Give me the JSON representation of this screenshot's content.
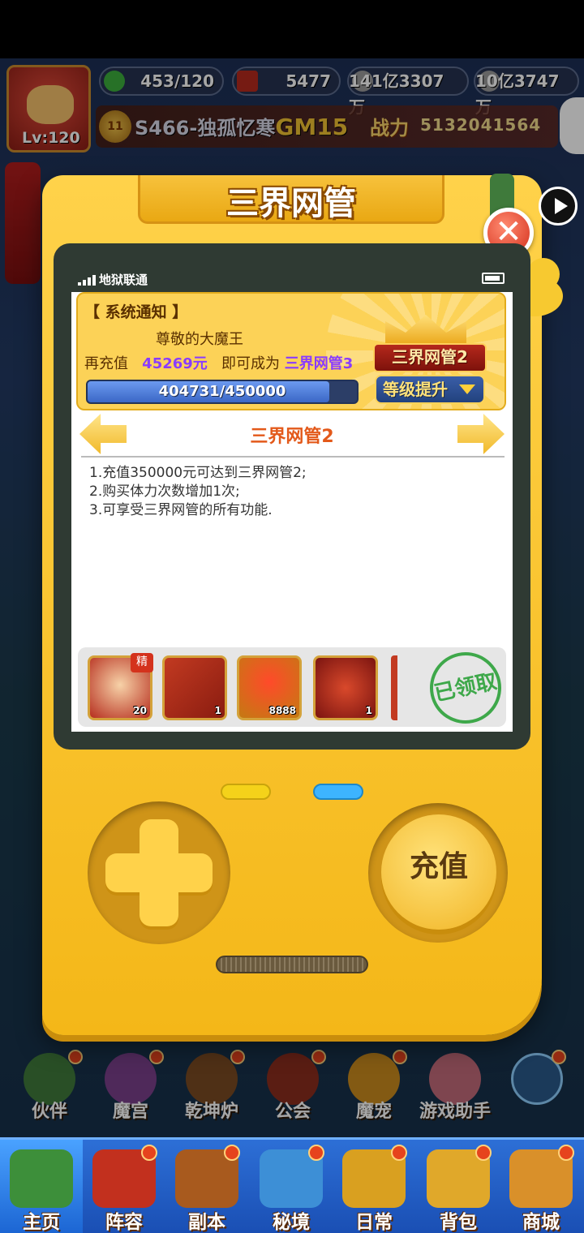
{
  "hud": {
    "level": "Lv:120",
    "stamina": "453/120",
    "gems": "5477",
    "coins": "141亿3307万",
    "silver": "10亿3747万",
    "server_name": "S466-独孤忆寒",
    "gm_tag": "GM15",
    "power_label": "战力",
    "power_value": "5132041564",
    "vip_badge": "11"
  },
  "modal": {
    "title": "三界网管",
    "close_symbol": "✕",
    "status_bar": {
      "carrier": "地狱联通"
    },
    "notice": {
      "header": "【 系统通知 】",
      "greeting": "尊敬的大魔王",
      "prefix": "再充值",
      "amount": "45269元",
      "middle": "即可成为",
      "target": "三界网管3",
      "progress_text": "404731/450000",
      "progress_ratio": 0.899,
      "rank": "三界网管2",
      "upgrade_label": "等级提升"
    },
    "level_title": "三界网管2",
    "description": [
      "1.充值350000元可达到三界网管2;",
      "2.购买体力次数增加1次;",
      "3.可享受三界网管的所有功能."
    ],
    "rewards": [
      {
        "tag": "精",
        "count": "20"
      },
      {
        "count": "1"
      },
      {
        "count": "8888"
      },
      {
        "count": "1"
      }
    ],
    "claimed_stamp": "已领取",
    "charge_button": "充值"
  },
  "icon_row": [
    {
      "label": "伙伴"
    },
    {
      "label": "魔宫"
    },
    {
      "label": "乾坤炉"
    },
    {
      "label": "公会"
    },
    {
      "label": "魔宠"
    },
    {
      "label": "游戏助手"
    }
  ],
  "nav": [
    {
      "label": "主页"
    },
    {
      "label": "阵容"
    },
    {
      "label": "副本"
    },
    {
      "label": "秘境"
    },
    {
      "label": "日常"
    },
    {
      "label": "背包"
    },
    {
      "label": "商城"
    }
  ]
}
